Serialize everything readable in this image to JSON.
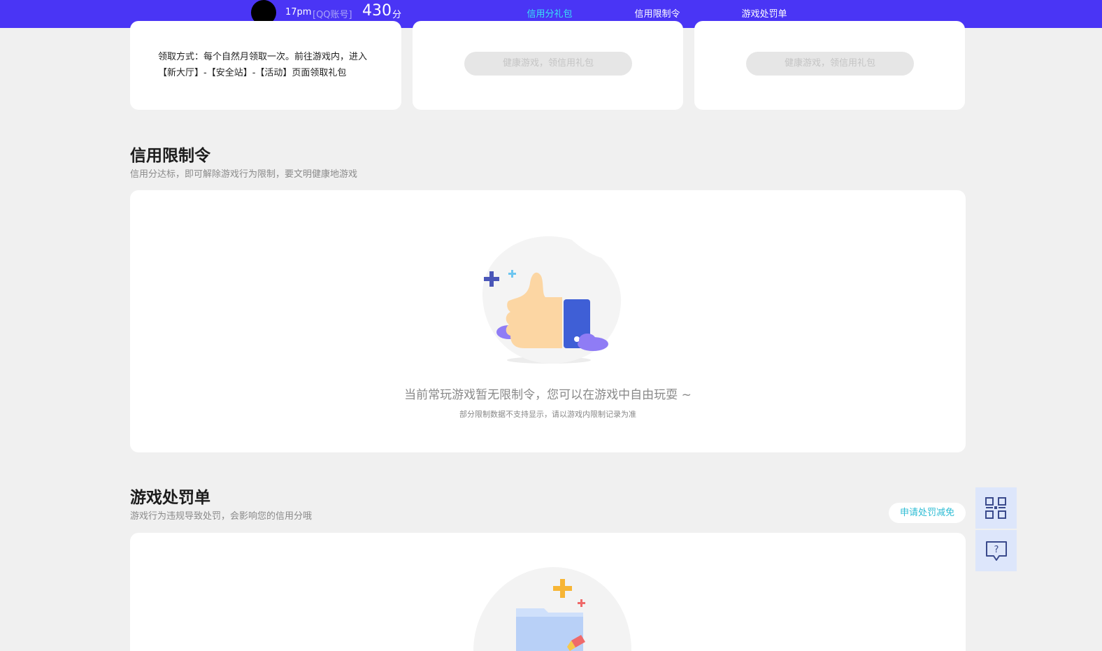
{
  "header": {
    "username": "17pm",
    "account_label": "[QQ账号]",
    "score": "430",
    "score_unit": "分",
    "tabs": [
      {
        "label": "信用分礼包",
        "active": true
      },
      {
        "label": "信用限制令",
        "active": false
      },
      {
        "label": "游戏处罚单",
        "active": false
      }
    ]
  },
  "gift_cards": {
    "description": "领取方式：每个自然月领取一次。前往游戏内，进入【新大厅】-【安全站】-【活动】页面领取礼包",
    "button_label": "健康游戏，领信用礼包"
  },
  "restriction": {
    "title": "信用限制令",
    "subtitle": "信用分达标，即可解除游戏行为限制，要文明健康地游戏",
    "empty_message": "当前常玩游戏暂无限制令，您可以在游戏中自由玩耍 ~",
    "empty_note": "部分限制数据不支持显示，请以游戏内限制记录为准"
  },
  "penalty": {
    "title": "游戏处罚单",
    "subtitle": "游戏行为违规导致处罚，会影响您的信用分哦",
    "appeal_button": "申请处罚减免"
  },
  "side_widgets": {
    "qr_icon": "qr-code-icon",
    "help_icon": "help-chat-icon"
  },
  "colors": {
    "header_bg": "#4a35f5",
    "active_tab": "#38e4f5",
    "page_bg": "#f0f0f0",
    "appeal_text": "#2dbcd4",
    "side_widget_bg": "#dde6fb"
  }
}
